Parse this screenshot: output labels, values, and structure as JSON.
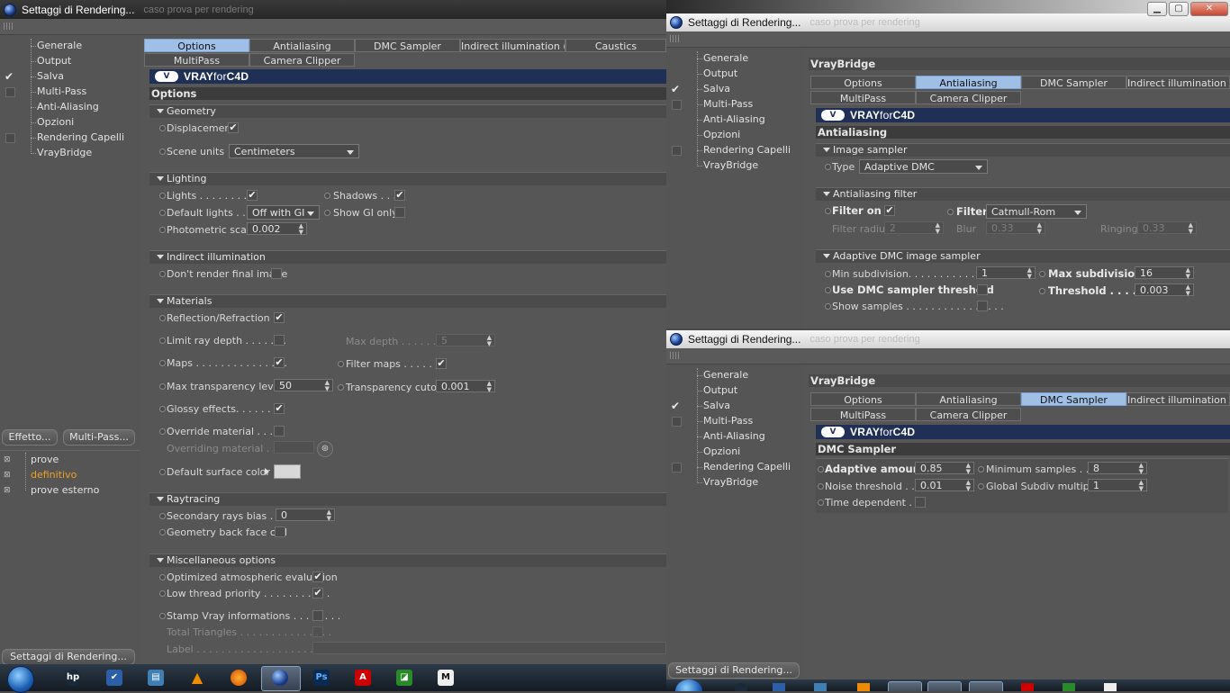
{
  "window_title": "Settaggi di Rendering...",
  "window_title_bg": "caso prova per rendering",
  "nav_items": [
    "Generale",
    "Output",
    "Salva",
    "Multi-Pass",
    "Anti-Aliasing",
    "Opzioni",
    "Rendering Capelli",
    "VrayBridge"
  ],
  "buttons": {
    "effetto": "Effetto...",
    "multipass": "Multi-Pass..."
  },
  "render_presets": [
    "prove",
    "definitivo",
    "prove esterno"
  ],
  "bottom_button": "Settaggi di Rendering...",
  "tabs": [
    "Options",
    "Antialiasing",
    "DMC Sampler",
    "Indirect illumination (GI)",
    "Caustics",
    "MultiPass",
    "Camera Clipper"
  ],
  "tabs_short": [
    "Options",
    "Antialiasing",
    "DMC Sampler",
    "Indirect illumination (GI)",
    "MultiPass",
    "Camera Clipper"
  ],
  "logo": {
    "mark": "V",
    "brand_a": "VRAY",
    "brand_b": "for",
    "brand_c": "C4D"
  },
  "vraybridge_title": "VrayBridge",
  "options": {
    "title": "Options",
    "geometry": {
      "header": "Geometry",
      "displacement": "Displacement",
      "scene_units": "Scene units",
      "scene_units_value": "Centimeters"
    },
    "lighting": {
      "header": "Lighting",
      "lights": "Lights . . . . . . . . .",
      "shadows": "Shadows . . .",
      "default_lights": "Default lights . . .",
      "default_lights_value": "Off with GI",
      "show_gi_only": "Show GI only",
      "photometric_scale": "Photometric scale",
      "photometric_scale_value": "0.002"
    },
    "indirect": {
      "header": "Indirect illumination",
      "dont_render": "Don't render final image"
    },
    "materials": {
      "header": "Materials",
      "reflection": "Reflection/Refraction . .",
      "limit_ray": "Limit ray depth . . . . . . .",
      "max_depth": "Max depth . . . . . . .",
      "max_depth_value": "5",
      "maps": "Maps . . . . . . . . . . . . . . .",
      "filter_maps": "Filter maps . . . . . . .",
      "max_transparency": "Max transparency levels",
      "max_transparency_value": "50",
      "transparency_cutoff": "Transparency cutoff",
      "transparency_cutoff_value": "0.001",
      "glossy": "Glossy effects. . . . . . .",
      "override_material": "Override material . . . . .",
      "overriding_material": "Overriding material . . . .",
      "default_surface": "Default surface color"
    },
    "raytracing": {
      "header": "Raytracing",
      "secondary_bias": "Secondary rays bias . . .",
      "secondary_bias_value": "0",
      "back_face": "Geometry back face cull"
    },
    "misc": {
      "header": "Miscellaneous options",
      "optimized": "Optimized atmospheric evaluation",
      "low_thread": "Low thread priority . . . . . . . . . . .",
      "stamp": "Stamp Vray informations . . . . . . . .",
      "total_triangles": "Total Triangles . . . . . . . . . . . . . . .",
      "label": "Label . . . . . . . . . . . . . . . . . . . . . ."
    }
  },
  "antialiasing": {
    "title": "Antialiasing",
    "image_sampler": {
      "header": "Image sampler",
      "type": "Type",
      "type_value": "Adaptive DMC"
    },
    "filter": {
      "header": "Antialiasing filter",
      "filter_on": "Filter on",
      "filter": "Filter",
      "filter_value": "Catmull-Rom",
      "radius": "Filter radius",
      "radius_value": "2",
      "blur": "Blur",
      "blur_value": "0.33",
      "ringing": "Ringing",
      "ringing_value": "0.33"
    },
    "adaptive": {
      "header": "Adaptive DMC image sampler",
      "min_sub": "Min subdivision. . . . . . . . . . . . . .",
      "min_sub_value": "1",
      "max_sub": "Max subdivision",
      "max_sub_value": "16",
      "use_dmc": "Use DMC sampler threshold",
      "threshold": "Threshold . . . . .",
      "threshold_value": "0.003",
      "show_samples": "Show samples . . . . . . . . . . . . . . . ."
    }
  },
  "dmc": {
    "title": "DMC Sampler",
    "adaptive_amount": "Adaptive amount",
    "adaptive_amount_value": "0.85",
    "min_samples": "Minimum samples . . . .",
    "min_samples_value": "8",
    "noise_threshold": "Noise threshold . . .",
    "noise_threshold_value": "0.01",
    "global_subdiv": "Global Subdiv multiplier",
    "global_subdiv_value": "1",
    "time_dependent": "Time dependent . . ."
  },
  "taskbar_icons": [
    "hp",
    "check",
    "net",
    "vlc",
    "firefox",
    "c4d",
    "Ps",
    "acrobat",
    "pdf",
    "M"
  ],
  "colors": {
    "active_tab": "#9fbfe6",
    "vray_banner": "#1f2f55",
    "preset_active": "#f0a020"
  }
}
